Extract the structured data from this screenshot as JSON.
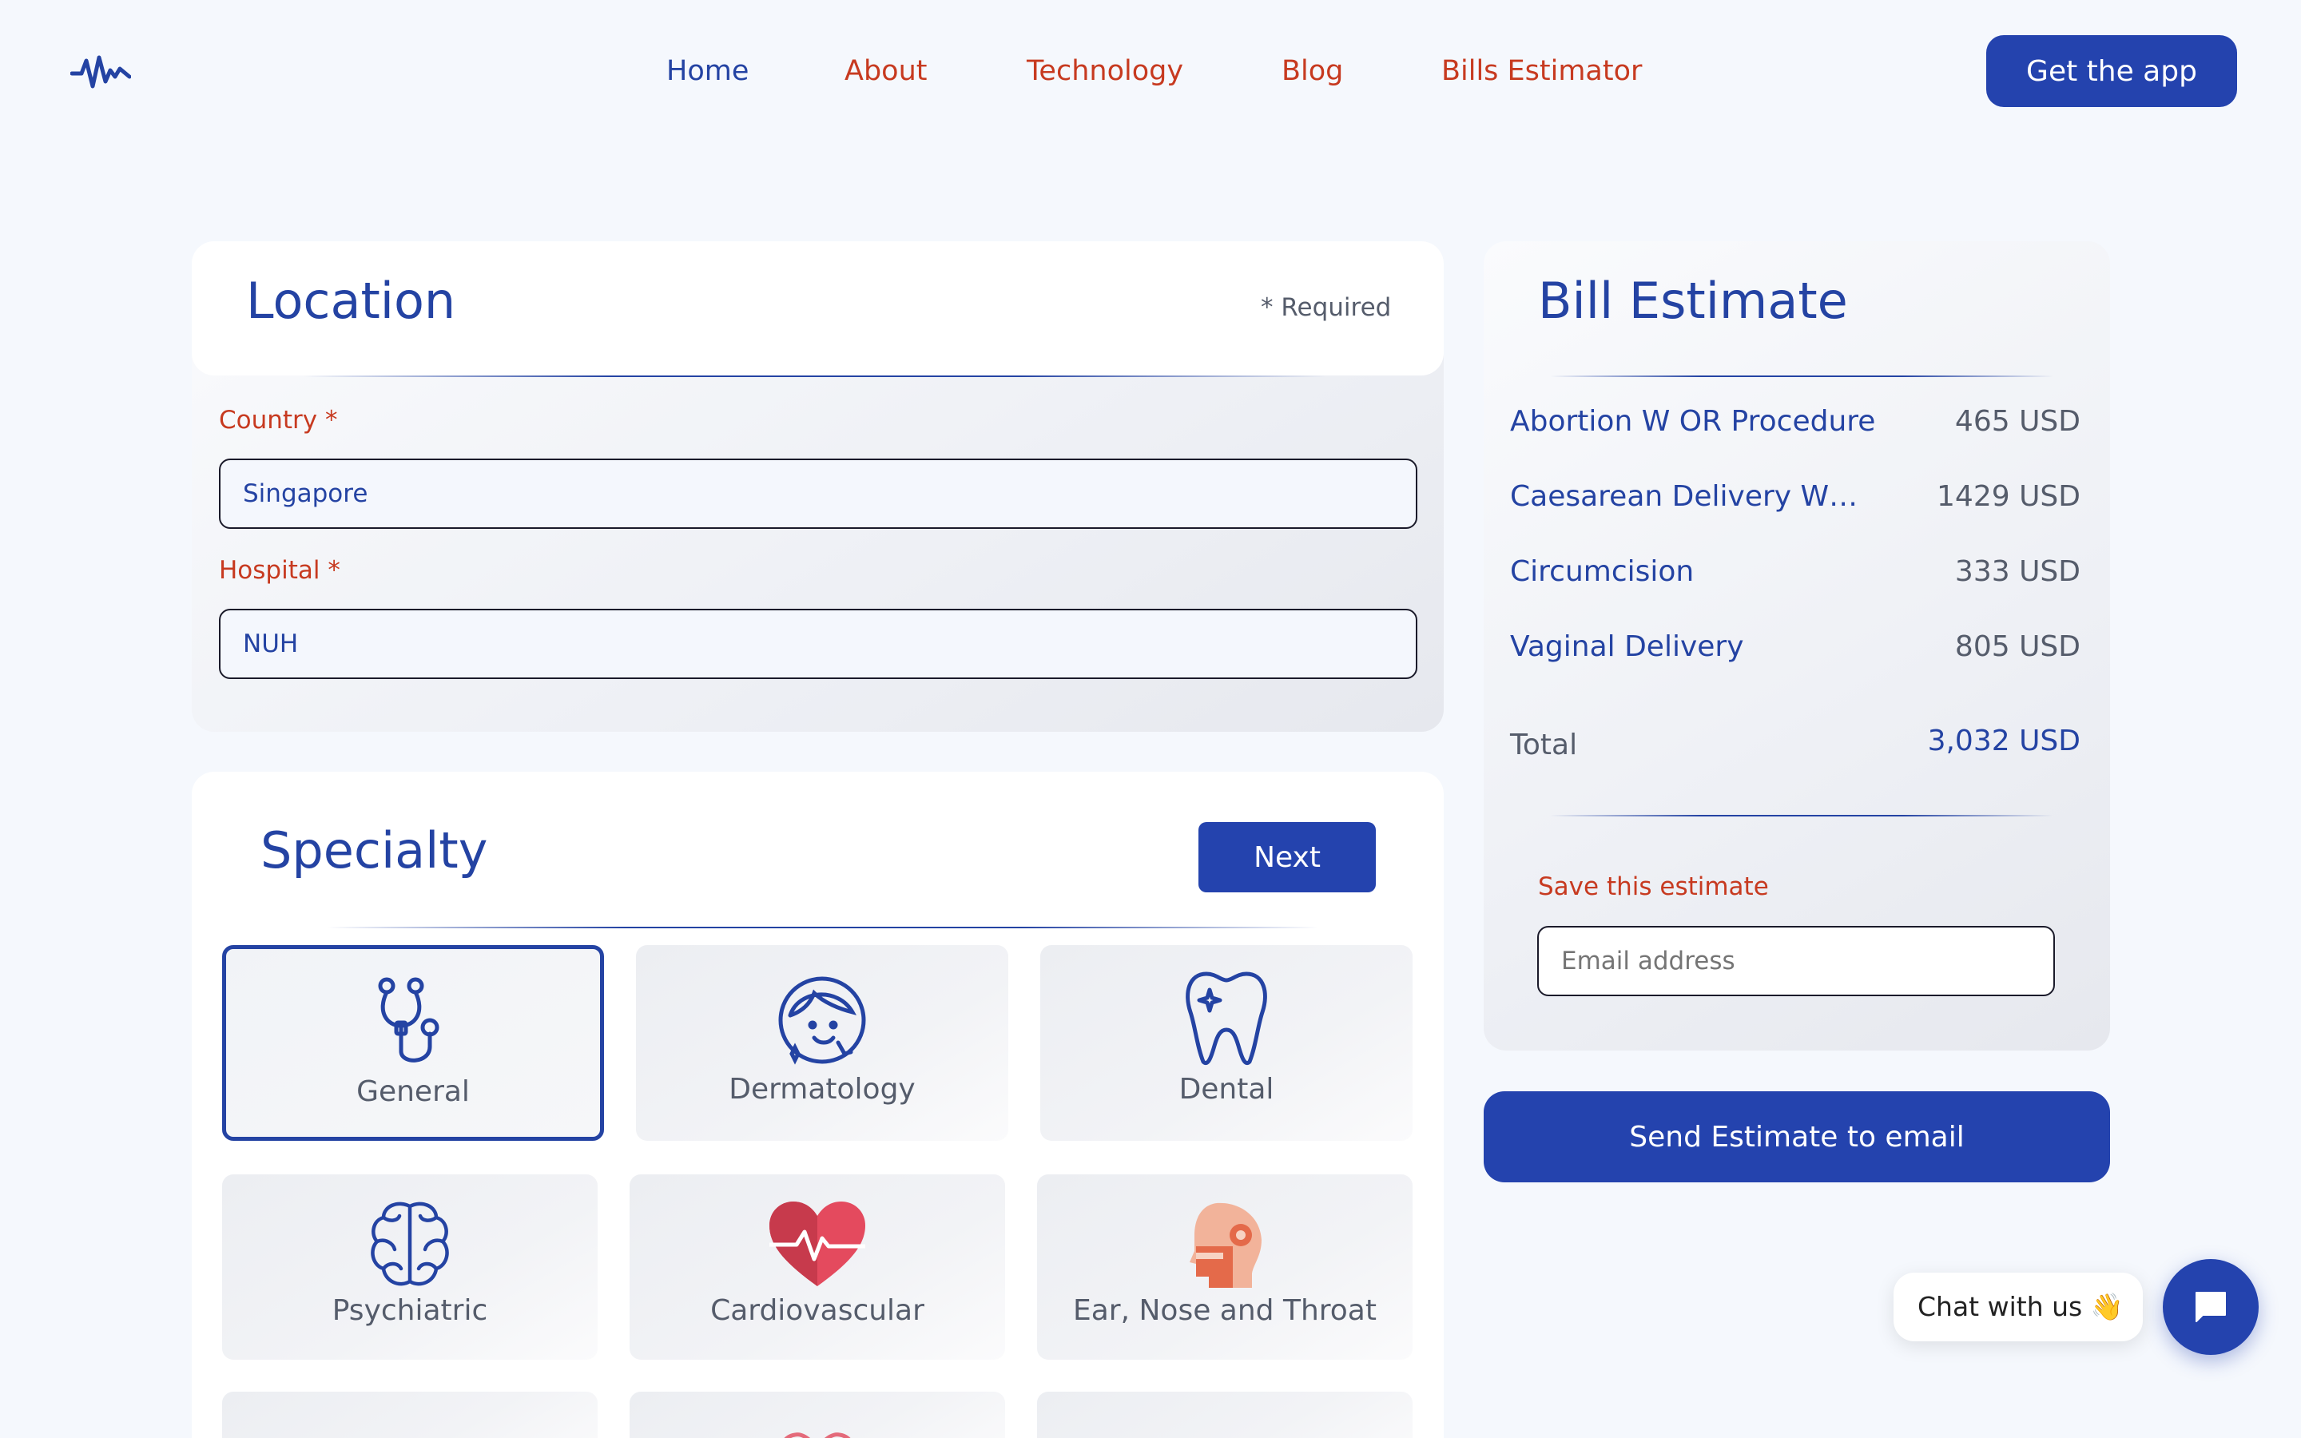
{
  "nav": {
    "items": [
      {
        "label": "Home"
      },
      {
        "label": "About"
      },
      {
        "label": "Technology"
      },
      {
        "label": "Blog"
      },
      {
        "label": "Bills Estimator"
      }
    ],
    "cta": "Get the app"
  },
  "location": {
    "title": "Location",
    "required_note": "* Required",
    "country_label": "Country *",
    "country_value": "Singapore",
    "hospital_label": "Hospital *",
    "hospital_value": "NUH"
  },
  "specialty": {
    "title": "Specialty",
    "next_label": "Next",
    "tiles": [
      {
        "label": "General",
        "icon": "stethoscope-icon",
        "selected": true
      },
      {
        "label": "Dermatology",
        "icon": "face-icon"
      },
      {
        "label": "Dental",
        "icon": "tooth-icon"
      },
      {
        "label": "Psychiatric",
        "icon": "brain-icon"
      },
      {
        "label": "Cardiovascular",
        "icon": "heart-icon"
      },
      {
        "label": "Ear, Nose and Throat",
        "icon": "head-ent-icon"
      }
    ]
  },
  "bill": {
    "title": "Bill Estimate",
    "items": [
      {
        "name": "Abortion W OR Procedure",
        "amount": "465 USD"
      },
      {
        "name": "Caesarean Delivery W…",
        "amount": "1429 USD"
      },
      {
        "name": "Circumcision",
        "amount": "333 USD"
      },
      {
        "name": "Vaginal Delivery",
        "amount": "805 USD"
      }
    ],
    "total_label": "Total",
    "total_value": "3,032 USD",
    "save_label": "Save this estimate",
    "email_placeholder": "Email address",
    "send_label": "Send Estimate to email"
  },
  "chat": {
    "label": "Chat with us 👋"
  },
  "colors": {
    "brand": "#2443ae",
    "accent": "#c73a20",
    "background": "#f5f8fd"
  }
}
